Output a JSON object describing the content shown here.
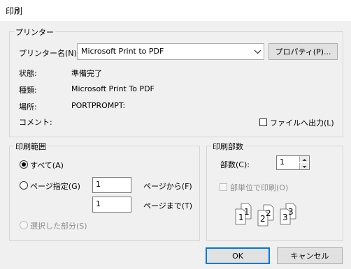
{
  "window": {
    "title": "印刷"
  },
  "printer": {
    "group_label": "プリンター",
    "name_label": "プリンター名(N):",
    "selected_printer": "Microsoft Print to PDF",
    "properties_button": "プロパティ(P)...",
    "status_label": "状態:",
    "status_value": "準備完了",
    "type_label": "種類:",
    "type_value": "Microsoft Print To PDF",
    "location_label": "場所:",
    "location_value": "PORTPROMPT:",
    "comment_label": "コメント:",
    "print_to_file_label": "ファイルへ出力(L)",
    "print_to_file_checked": false
  },
  "range": {
    "group_label": "印刷範囲",
    "all_label": "すべて(A)",
    "pages_label": "ページ指定(G)",
    "from_value": "1",
    "from_label": "ページから(F)",
    "to_value": "1",
    "to_label": "ページまで(T)",
    "selection_label": "選択した部分(S)",
    "selected_option": "all"
  },
  "copies": {
    "group_label": "印刷部数",
    "count_label": "部数(C):",
    "count_value": "1",
    "collate_label": "部単位で印刷(O)",
    "collate_checked": false,
    "collate_pages": [
      "1",
      "1",
      "2",
      "2",
      "3",
      "3"
    ]
  },
  "buttons": {
    "ok": "OK",
    "cancel": "キャンセル"
  }
}
